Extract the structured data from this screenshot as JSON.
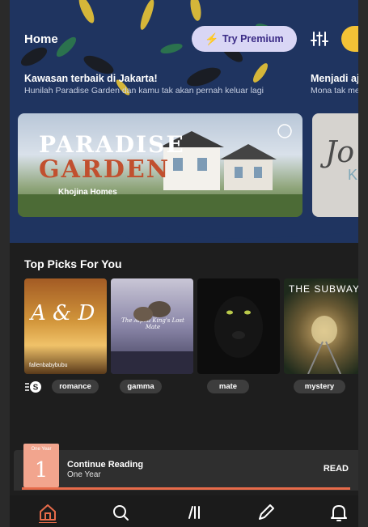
{
  "header": {
    "title": "Home",
    "premium_label": "Try Premium",
    "premium_icon": "bolt-icon",
    "filter_icon": "filter-sliders-icon",
    "coins_icon": "coins-icon"
  },
  "banners": [
    {
      "headline": "Kawasan terbaik di Jakarta!",
      "subtext": "Hunilah Paradise Garden dan kamu tak akan pernah keluar lagi",
      "image_text_1": "PARADISE",
      "image_text_2": "GARDEN",
      "image_text_3": "Khojina Homes"
    },
    {
      "headline": "Menjadi aj",
      "subtext": "Mona tak me",
      "image_text_1": "Jo",
      "image_text_2": "Ki"
    }
  ],
  "top_picks": {
    "title": "Top Picks For You",
    "badge_icon": "coin-s-icon",
    "books": [
      {
        "cover_title": "A & D",
        "cover_author": "fallenbabybubu",
        "tag": "romance"
      },
      {
        "cover_title": "The Alpha King's Lost Mate",
        "tag": "gamma"
      },
      {
        "cover_title": "",
        "tag": "mate"
      },
      {
        "cover_title": "THE SUBWAY",
        "tag": "mystery"
      }
    ]
  },
  "continue_reading": {
    "label": "Continue Reading",
    "book_title": "One Year",
    "cover_small": "One Year",
    "cover_number": "1",
    "action": "READ",
    "progress": 1.0
  },
  "nav": [
    {
      "icon": "home-icon",
      "active": true
    },
    {
      "icon": "search-icon",
      "active": false
    },
    {
      "icon": "library-icon",
      "active": false
    },
    {
      "icon": "pencil-icon",
      "active": false
    },
    {
      "icon": "bell-icon",
      "active": false
    }
  ],
  "colors": {
    "hero_bg": "#1f3460",
    "accent": "#e76b4a",
    "premium_bg": "#d9d6f5",
    "coin": "#f3c236"
  }
}
